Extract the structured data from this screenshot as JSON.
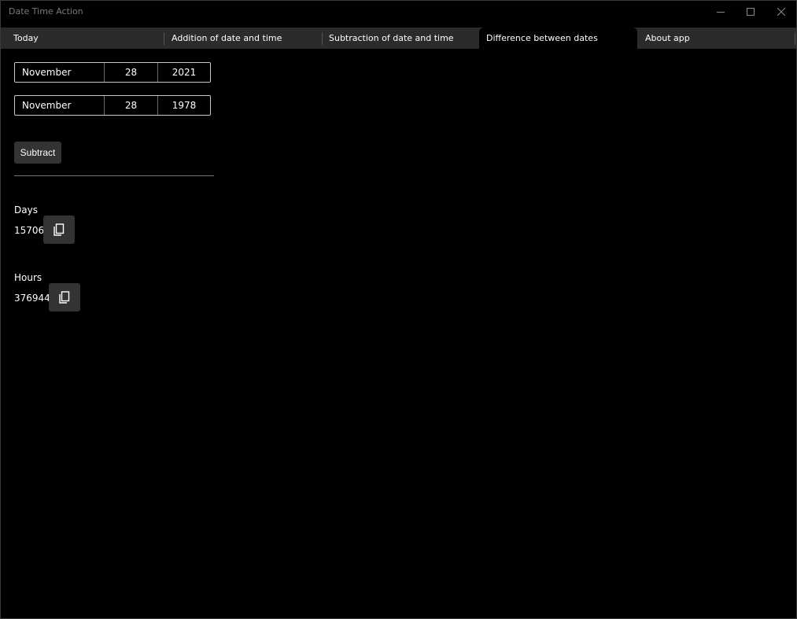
{
  "window": {
    "title": "Date Time Action"
  },
  "tabs": [
    {
      "label": "Today",
      "selected": false
    },
    {
      "label": "Addition of date and time",
      "selected": false
    },
    {
      "label": "Subtraction of date and time",
      "selected": false
    },
    {
      "label": "Difference between dates",
      "selected": true
    },
    {
      "label": "About app",
      "selected": false
    }
  ],
  "first_date": {
    "month": "November",
    "day": "28",
    "year": "2021"
  },
  "second_date": {
    "month": "November",
    "day": "28",
    "year": "1978"
  },
  "subtract_label": "Subtract",
  "results": {
    "days": {
      "label": "Days",
      "value": "15706"
    },
    "hours": {
      "label": "Hours",
      "value": "376944"
    }
  },
  "colors": {
    "background": "#000000",
    "tab_strip": "#2b2b2b",
    "button": "#333333",
    "divider": "#5e78a8"
  }
}
